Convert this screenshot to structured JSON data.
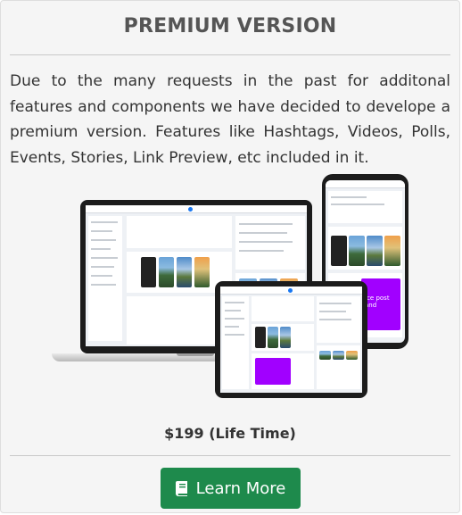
{
  "card": {
    "title": "PREMIUM VERSION",
    "description": "Due to the many requests in the past for additonal features and components we have decided to develope a premium version. Features like Hashtags, Videos, Polls, Events, Stories, Link Preview, etc included in it.",
    "price": "$199 (Life Time)",
    "button_label": "Learn More",
    "button_icon": "book-icon",
    "accent_color": "#1e8a4c"
  },
  "illustration": {
    "phone_card_text": "Ice post\nand"
  }
}
